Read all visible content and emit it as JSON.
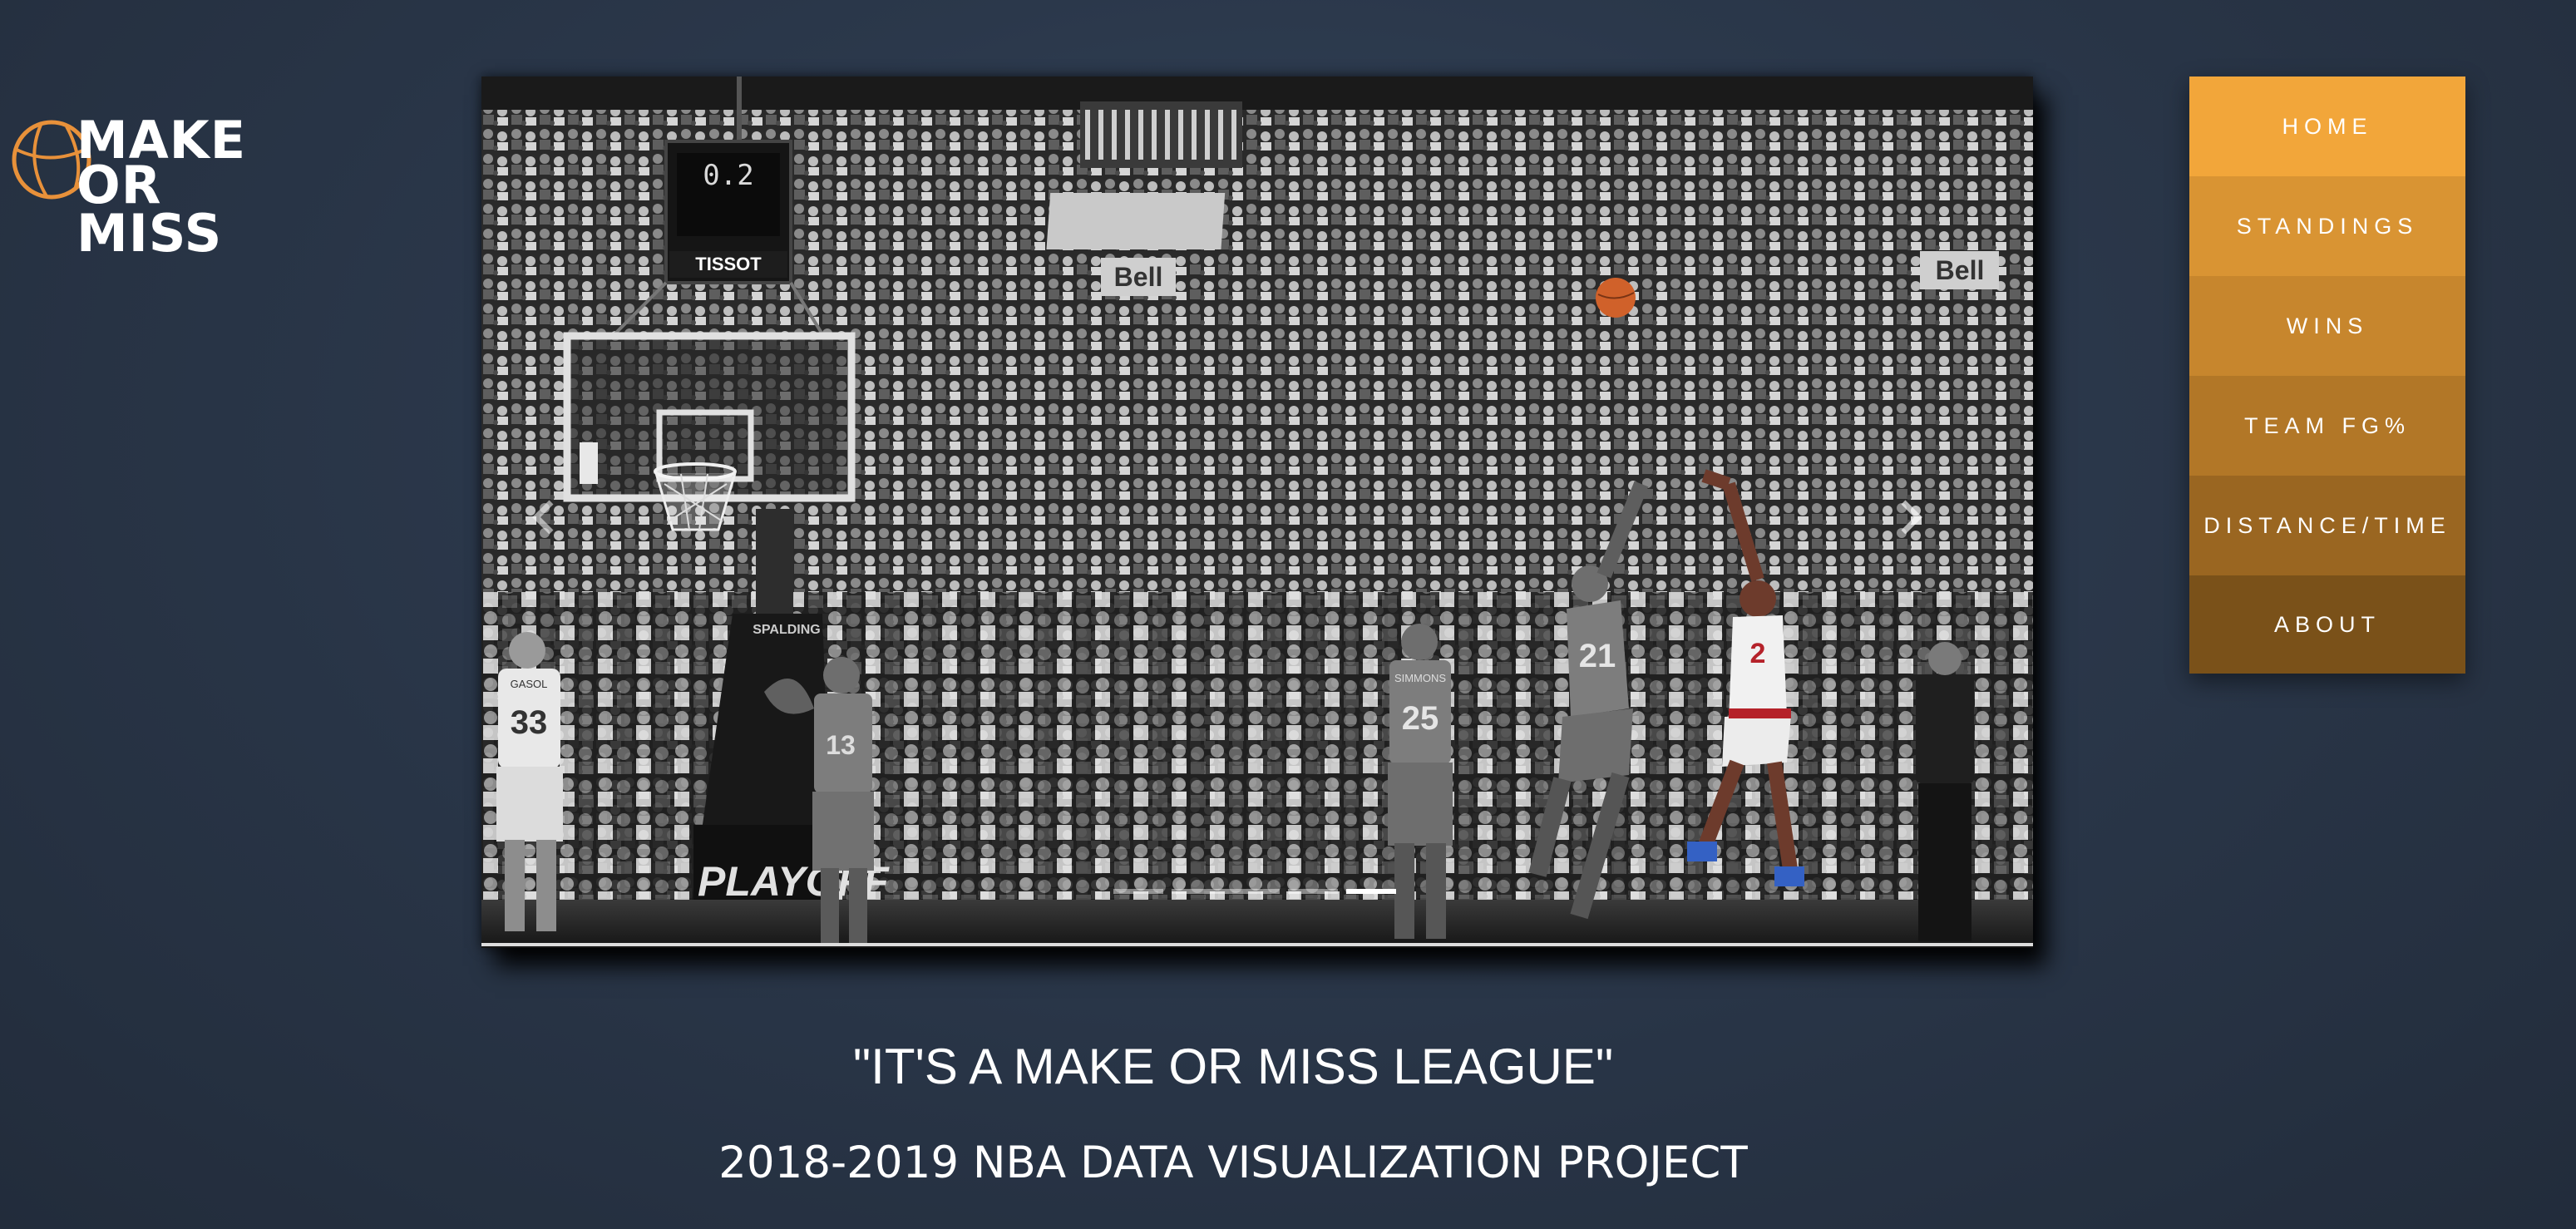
{
  "logo": {
    "line1": "MAKE",
    "line2": "OR MISS",
    "icon": "basketball-icon",
    "accent": "#e8913a"
  },
  "hero": {
    "scoreboard": "0.2",
    "scoreboard_brand": "TISSOT",
    "sign_left": "Bell",
    "sign_right": "Bell",
    "stanchion_brand": "SPALDING",
    "playoffs": "PLAYOFF",
    "jerseys": [
      "33",
      "13",
      "25",
      "21",
      "2"
    ],
    "jersey_name_33": "GASOL",
    "jersey_name_25": "SIMMONS",
    "slides": 5,
    "active_slide": 4
  },
  "nav": {
    "items": [
      {
        "label": "HOME"
      },
      {
        "label": "STANDINGS"
      },
      {
        "label": "WINS"
      },
      {
        "label": "TEAM FG%"
      },
      {
        "label": "DISTANCE/TIME"
      },
      {
        "label": "ABOUT"
      }
    ]
  },
  "tagline": "\"IT'S A MAKE OR MISS LEAGUE\"",
  "subtitle": "2018-2019 NBA DATA VISUALIZATION PROJECT",
  "colors": {
    "nav_top": "#f2a63a",
    "nav_bottom": "#7a5119",
    "ball": "#d0612a",
    "jersey_red": "#b5222a"
  }
}
